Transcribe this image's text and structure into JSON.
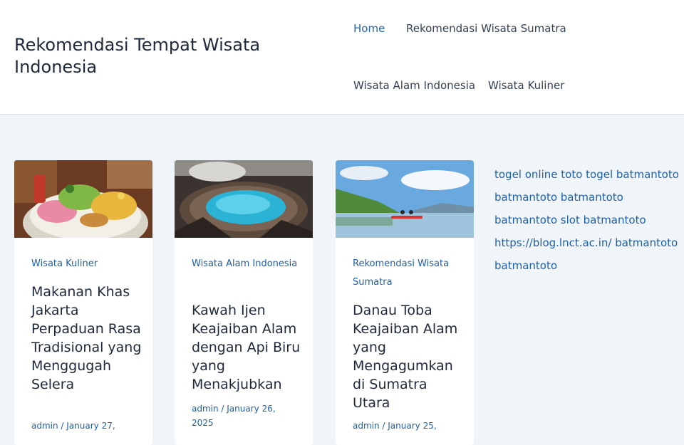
{
  "site": {
    "title": "Rekomendasi Tempat Wisata Indonesia"
  },
  "nav": {
    "items": [
      {
        "label": "Home"
      },
      {
        "label": "Rekomendasi Wisata Sumatra"
      },
      {
        "label": "Wisata Alam Indonesia"
      },
      {
        "label": "Wisata Kuliner"
      }
    ]
  },
  "posts": [
    {
      "category": "Wisata Kuliner",
      "title": "Makanan Khas Jakarta Perpaduan Rasa Tradisional yang Menggugah Selera",
      "meta": "admin / January 27,"
    },
    {
      "category": "Wisata Alam Indonesia",
      "title": "Kawah Ijen Keajaiban Alam dengan Api Biru yang Menakjubkan",
      "meta": "admin / January 26, 2025"
    },
    {
      "category": "Rekomendasi Wisata Sumatra",
      "title": "Danau Toba Keajaiban Alam yang Mengagumkan di Sumatra Utara",
      "meta": "admin / January 25,"
    }
  ],
  "sidebar": {
    "links": [
      {
        "label": "togel online toto togel batmantoto"
      },
      {
        "label": "batmantoto batmantoto"
      },
      {
        "label": "batmantoto slot batmantoto"
      },
      {
        "label": "https://blog.lnct.ac.in/ batmantoto"
      },
      {
        "label": "batmantoto"
      }
    ]
  },
  "colors": {
    "accent": "#1f5fa8",
    "background": "#f0f5fa",
    "card": "#ffffff"
  }
}
